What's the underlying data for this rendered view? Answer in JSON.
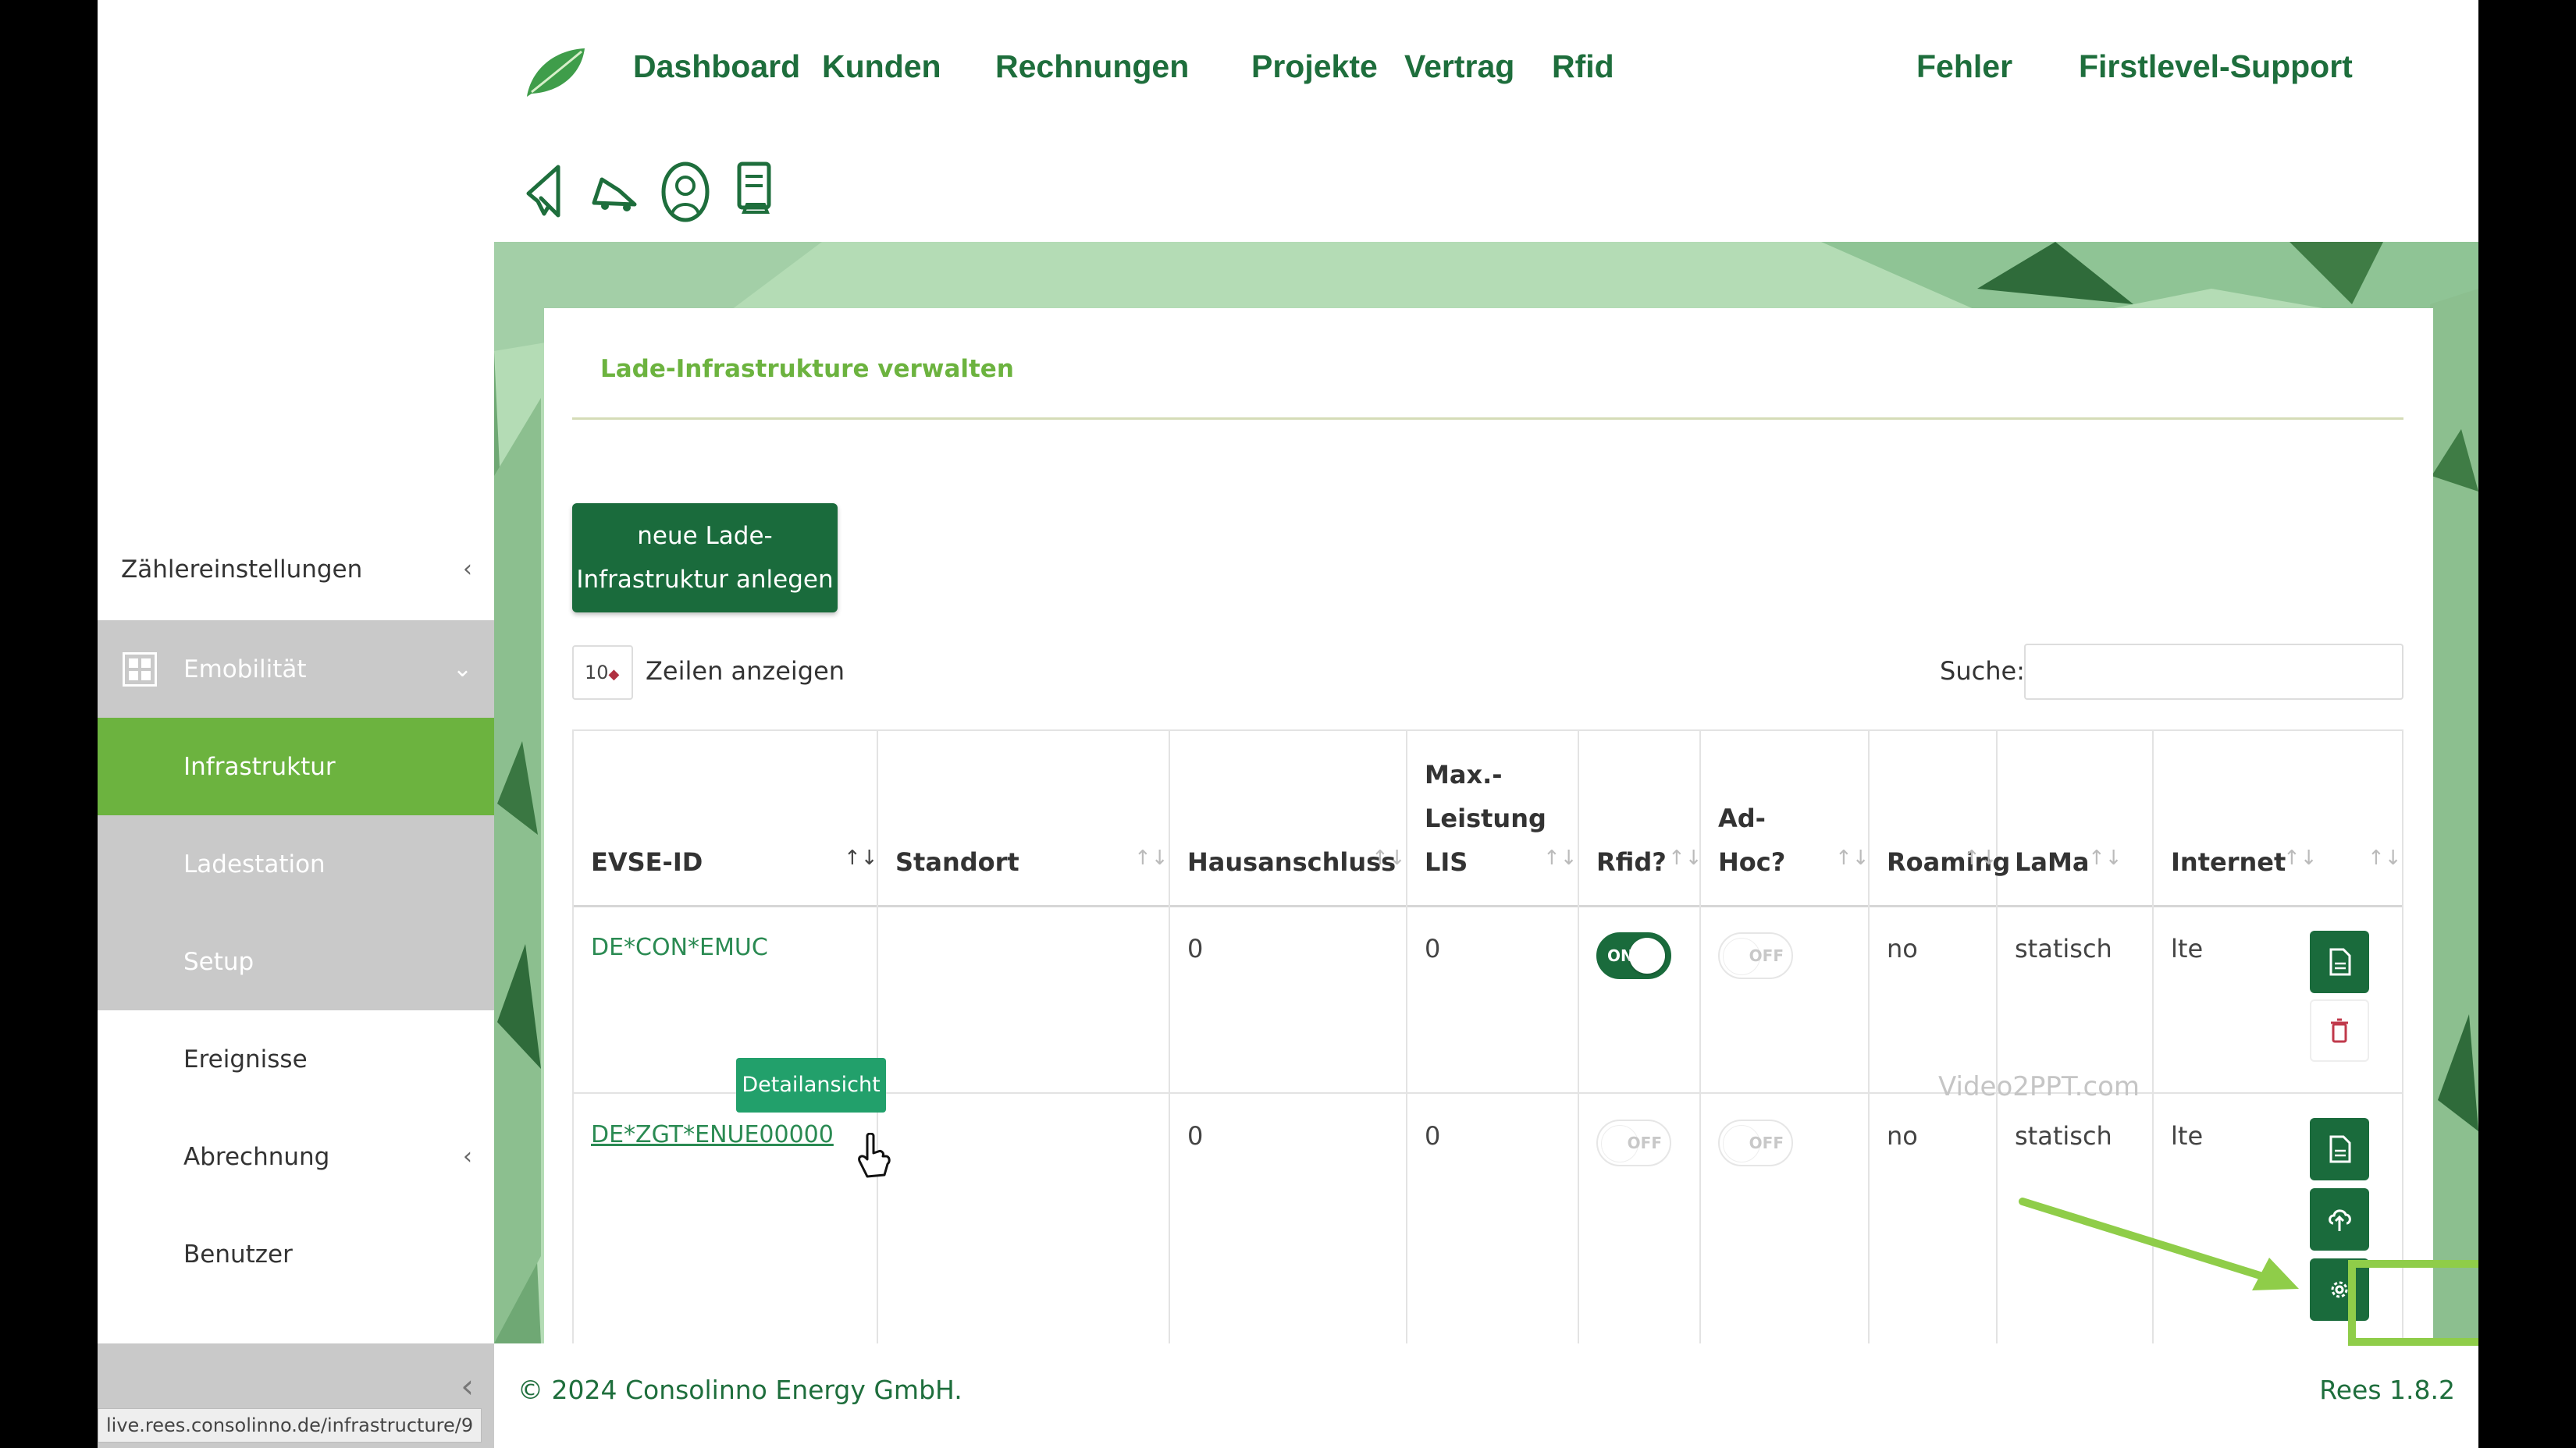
{
  "nav": {
    "items": [
      "Dashboard",
      "Kunden",
      "Rechnungen",
      "Projekte",
      "Vertrag",
      "Rfid",
      "Fehler",
      "Firstlevel-Support"
    ],
    "tool_icons": [
      "megaphone-icon",
      "car-icon",
      "support-headset-icon",
      "document-car-icon"
    ]
  },
  "sidebar": {
    "items": [
      {
        "label": "Zählereinstellungen",
        "chevron": "‹",
        "state": "default"
      },
      {
        "label": "Emobilität",
        "chevron": "⌄",
        "state": "expanded",
        "icon": "grid-icon"
      },
      {
        "label": "Infrastruktur",
        "state": "active"
      },
      {
        "label": "Ladestation",
        "state": "sub"
      },
      {
        "label": "Setup",
        "state": "sub"
      },
      {
        "label": "Ereignisse",
        "state": "default"
      },
      {
        "label": "Abrechnung",
        "chevron": "‹",
        "state": "default"
      },
      {
        "label": "Benutzer",
        "state": "default"
      }
    ],
    "collapse_glyph": "‹"
  },
  "status_url": "live.rees.consolinno.de/infrastructure/9",
  "card": {
    "title": "Lade-Infrastrukture verwalten",
    "new_button_line1": "neue Lade-",
    "new_button_line2": "Infrastruktur anlegen",
    "page_length": "10",
    "page_length_label": "Zeilen anzeigen",
    "search_label": "Suche:",
    "search_value": ""
  },
  "table": {
    "columns": {
      "evse": "EVSE-ID",
      "standort": "Standort",
      "hausanschluss": "Hausanschluss",
      "max1": "Max.-",
      "max2": "Leistung",
      "max3": "LIS",
      "rfid": "Rfid?",
      "adhoc1": "Ad-",
      "adhoc2": "Hoc?",
      "roaming": "Roaming",
      "lama": "LaMa",
      "internet": "Internet"
    },
    "rows": [
      {
        "evse": "DE*CON*EMUC",
        "standort": "",
        "hausanschluss": "0",
        "max_leistung": "0",
        "rfid": "ON",
        "adhoc": "OFF",
        "roaming": "no",
        "lama": "statisch",
        "internet": "lte"
      },
      {
        "evse": "DE*ZGT*ENUE00000",
        "standort": "",
        "hausanschluss": "0",
        "max_leistung": "0",
        "rfid": "OFF",
        "adhoc": "OFF",
        "roaming": "no",
        "lama": "statisch",
        "internet": "lte"
      }
    ],
    "sort_glyph": "↑↓",
    "sort_active_glyph": "↑↓"
  },
  "tooltip": "Detailansicht",
  "watermark": "Video2PPT.com",
  "footer": {
    "copyright": "© 2024 Consolinno Energy GmbH.",
    "version": "Rees 1.8.2"
  },
  "colors": {
    "brand_dark_green": "#1a6b3c",
    "brand_light_green": "#6cb33f",
    "annotation_green": "#8fcd49"
  }
}
